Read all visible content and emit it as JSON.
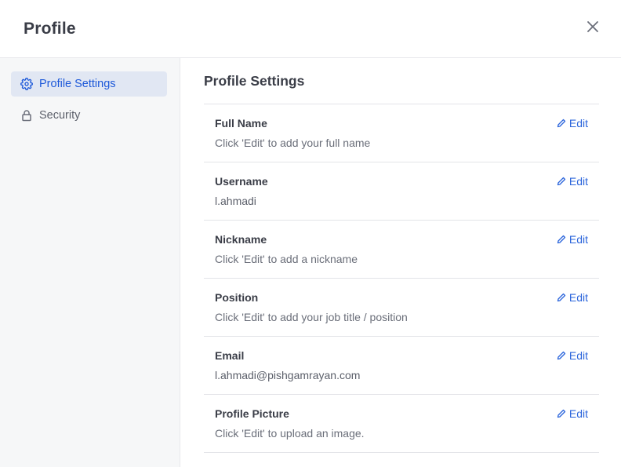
{
  "header": {
    "title": "Profile"
  },
  "sidebar": {
    "items": [
      {
        "label": "Profile Settings",
        "icon": "gear-icon",
        "active": true
      },
      {
        "label": "Security",
        "icon": "lock-icon",
        "active": false
      }
    ]
  },
  "main": {
    "title": "Profile Settings",
    "edit_label": "Edit",
    "rows": [
      {
        "label": "Full Name",
        "value": "Click 'Edit' to add your full name"
      },
      {
        "label": "Username",
        "value": "l.ahmadi"
      },
      {
        "label": "Nickname",
        "value": "Click 'Edit' to add a nickname"
      },
      {
        "label": "Position",
        "value": "Click 'Edit' to add your job title / position"
      },
      {
        "label": "Email",
        "value": "l.ahmadi@pishgamrayan.com"
      },
      {
        "label": "Profile Picture",
        "value": "Click 'Edit' to upload an image."
      }
    ]
  },
  "colors": {
    "accent": "#1c58d9",
    "link": "#2a64db",
    "sidebar_bg": "#f6f7f8",
    "active_bg": "#e1e7f3"
  }
}
